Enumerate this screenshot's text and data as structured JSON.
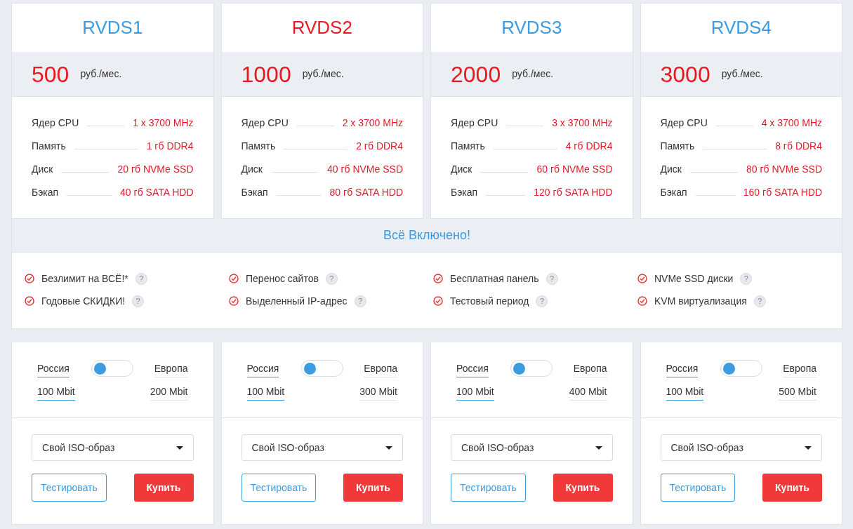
{
  "plans": [
    {
      "name": "RVDS1",
      "highlighted": false,
      "price": "500",
      "unit": "руб./мес.",
      "specs": [
        {
          "label": "Ядер CPU",
          "value": "1 x 3700 MHz"
        },
        {
          "label": "Память",
          "value": "1 гб DDR4"
        },
        {
          "label": "Диск",
          "value": "20 гб NVMe SSD"
        },
        {
          "label": "Бэкап",
          "value": "40 гб SATA HDD"
        }
      ]
    },
    {
      "name": "RVDS2",
      "highlighted": true,
      "price": "1000",
      "unit": "руб./мес.",
      "specs": [
        {
          "label": "Ядер CPU",
          "value": "2 x 3700 MHz"
        },
        {
          "label": "Память",
          "value": "2 гб DDR4"
        },
        {
          "label": "Диск",
          "value": "40 гб NVMe SSD"
        },
        {
          "label": "Бэкап",
          "value": "80 гб SATA HDD"
        }
      ]
    },
    {
      "name": "RVDS3",
      "highlighted": false,
      "price": "2000",
      "unit": "руб./мес.",
      "specs": [
        {
          "label": "Ядер CPU",
          "value": "3 x 3700 MHz"
        },
        {
          "label": "Память",
          "value": "4 гб DDR4"
        },
        {
          "label": "Диск",
          "value": "60 гб NVMe SSD"
        },
        {
          "label": "Бэкап",
          "value": "120 гб SATA HDD"
        }
      ]
    },
    {
      "name": "RVDS4",
      "highlighted": false,
      "price": "3000",
      "unit": "руб./мес.",
      "specs": [
        {
          "label": "Ядер CPU",
          "value": "4 x 3700 MHz"
        },
        {
          "label": "Память",
          "value": "8 гб DDR4"
        },
        {
          "label": "Диск",
          "value": "80 гб NVMe SSD"
        },
        {
          "label": "Бэкап",
          "value": "160 гб SATA HDD"
        }
      ]
    }
  ],
  "included": {
    "title": "Всё Включено!",
    "help_mark": "?",
    "features": [
      "Безлимит на ВСЁ!*",
      "Перенос сайтов",
      "Бесплатная панель",
      "NVMe SSD диски",
      "Годовые СКИДКИ!",
      "Выделенный IP-адрес",
      "Тестовый период",
      "KVM виртуализация"
    ]
  },
  "orders": [
    {
      "locations": [
        {
          "name": "Россия",
          "speed": "100 Mbit",
          "selected": true
        },
        {
          "name": "Европа",
          "speed": "200 Mbit",
          "selected": false
        }
      ],
      "toggle_on": false,
      "image_select": "Свой ISO-образ",
      "test_button": "Тестировать",
      "buy_button": "Купить"
    },
    {
      "locations": [
        {
          "name": "Россия",
          "speed": "100 Mbit",
          "selected": true
        },
        {
          "name": "Европа",
          "speed": "300 Mbit",
          "selected": false
        }
      ],
      "toggle_on": false,
      "image_select": "Свой ISO-образ",
      "test_button": "Тестировать",
      "buy_button": "Купить"
    },
    {
      "locations": [
        {
          "name": "Россия",
          "speed": "100 Mbit",
          "selected": true
        },
        {
          "name": "Европа",
          "speed": "400 Mbit",
          "selected": false
        }
      ],
      "toggle_on": false,
      "image_select": "Свой ISO-образ",
      "test_button": "Тестировать",
      "buy_button": "Купить"
    },
    {
      "locations": [
        {
          "name": "Россия",
          "speed": "100 Mbit",
          "selected": true
        },
        {
          "name": "Европа",
          "speed": "500 Mbit",
          "selected": false
        }
      ],
      "toggle_on": false,
      "image_select": "Свой ISO-образ",
      "test_button": "Тестировать",
      "buy_button": "Купить"
    }
  ]
}
